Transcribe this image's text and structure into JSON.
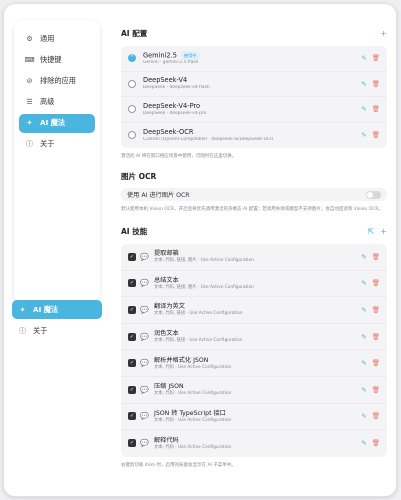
{
  "sidebar": {
    "items": [
      {
        "label": "通用",
        "icon": "gear-icon"
      },
      {
        "label": "快捷键",
        "icon": "keyboard-icon"
      },
      {
        "label": "排除的应用",
        "icon": "block-icon"
      },
      {
        "label": "高级",
        "icon": "sliders-icon"
      },
      {
        "label": "AI 魔法",
        "icon": "magic-wand-icon"
      },
      {
        "label": "关于",
        "icon": "info-icon"
      }
    ],
    "active_index": 4,
    "ghost_items": [
      {
        "label": "AI 魔法",
        "icon": "magic-wand-icon"
      },
      {
        "label": "关于",
        "icon": "info-icon"
      }
    ]
  },
  "ai_config": {
    "title": "AI 配置",
    "add_icon": "+",
    "models": [
      {
        "name": "Gemini2.5",
        "badge": "使用中",
        "sub": "Gemini · gemini-2.5-flash",
        "selected": true
      },
      {
        "name": "DeepSeek-V4",
        "sub": "DeepSeek · deepseek-v4-flash",
        "selected": false
      },
      {
        "name": "DeepSeek-V4-Pro",
        "sub": "DeepSeek · deepseek-v4-pro",
        "selected": false
      },
      {
        "name": "DeepSeek-OCR",
        "sub": "Custom (OpenAI Compatible) · deepseek-ai/DeepSeek-OCR",
        "selected": false
      }
    ],
    "hint": "激活的 AI 将在窗口相应场景中使用，可随时在这里切换。"
  },
  "ocr": {
    "title": "图片 OCR",
    "toggle_label": "使用 AI 进行图片 OCR",
    "enabled": false,
    "hint": "默认使用本机 Vision OCR。开启后将优先调用激活的多模态 AI 配置；若调用失败或模型不支持图片，会自动回退到 Vision OCR。"
  },
  "skills": {
    "title": "AI 技能",
    "header_icons": [
      "share-icon",
      "plus-icon"
    ],
    "items": [
      {
        "name": "提取邮箱",
        "sub": "文本, 代码, 链接, 图片 · Use Active Configuration"
      },
      {
        "name": "总结文本",
        "sub": "文本, 代码, 链接, 图片 · Use Active Configuration"
      },
      {
        "name": "翻译为英文",
        "sub": "文本, 代码, 链接 · Use Active Configuration"
      },
      {
        "name": "润色文本",
        "sub": "文本, 代码, 链接 · Use Active Configuration"
      },
      {
        "name": "解析并格式化 JSON",
        "sub": "文本, 代码 · Use Active Configuration"
      },
      {
        "name": "压缩 JSON",
        "sub": "文本, 代码 · Use Active Configuration"
      },
      {
        "name": "JSON 转 TypeScript 接口",
        "sub": "文本, 代码 · Use Active Configuration"
      },
      {
        "name": "解释代码",
        "sub": "文本, 代码 · Use Active Configuration"
      }
    ],
    "hint": "右键剪切板 item 时，启用的技能会显示在 AI 子菜单中。"
  },
  "colors": {
    "accent": "#4ab6df",
    "delete": "#e9726a"
  }
}
